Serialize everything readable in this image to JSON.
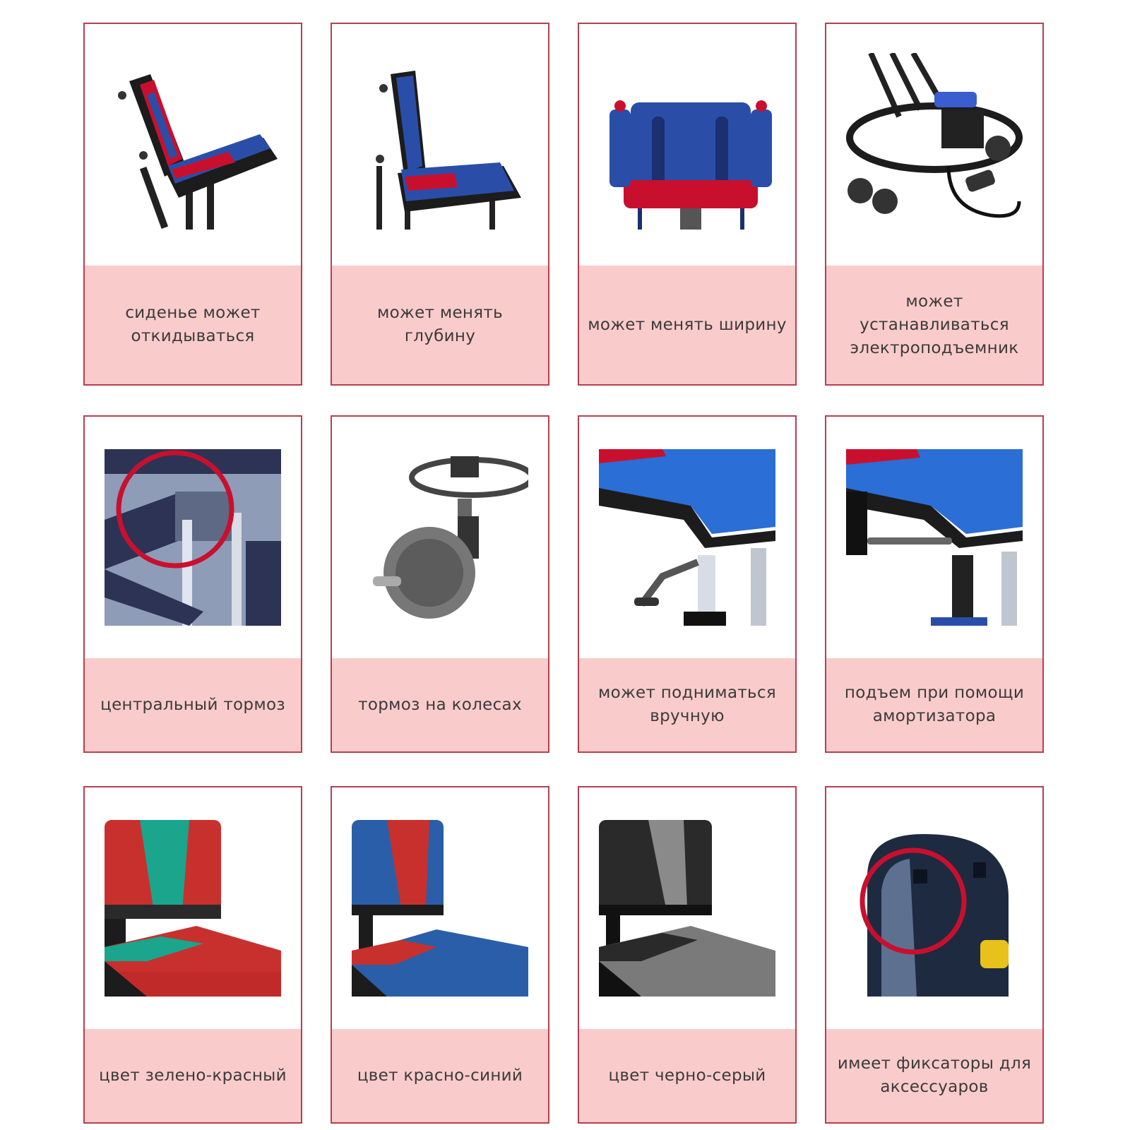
{
  "colors": {
    "border": "#b5404f",
    "caption_bg": "#f9cccb",
    "caption_text": "#3b3b3b"
  },
  "cards": [
    {
      "caption": "сиденье может откидываться",
      "icon": "reclining-seat-icon"
    },
    {
      "caption": "может менять глубину",
      "icon": "seat-depth-icon"
    },
    {
      "caption": "может менять ширину",
      "icon": "seat-width-icon"
    },
    {
      "caption": "может устанавливаться электроподъемник",
      "icon": "electric-lift-icon"
    },
    {
      "caption": "центральный тормоз",
      "icon": "central-brake-icon"
    },
    {
      "caption": "тормоз на колесах",
      "icon": "wheel-brake-icon"
    },
    {
      "caption": "может подниматься вручную",
      "icon": "manual-lift-icon"
    },
    {
      "caption": "подъем при помощи амортизатора",
      "icon": "gas-spring-lift-icon"
    },
    {
      "caption": "цвет зелено-красный",
      "icon": "green-red-seat-icon"
    },
    {
      "caption": "цвет красно-синий",
      "icon": "red-blue-seat-icon"
    },
    {
      "caption": "цвет черно-серый",
      "icon": "black-grey-seat-icon"
    },
    {
      "caption": "имеет фиксаторы для аксессуаров",
      "icon": "accessory-lock-icon"
    }
  ]
}
